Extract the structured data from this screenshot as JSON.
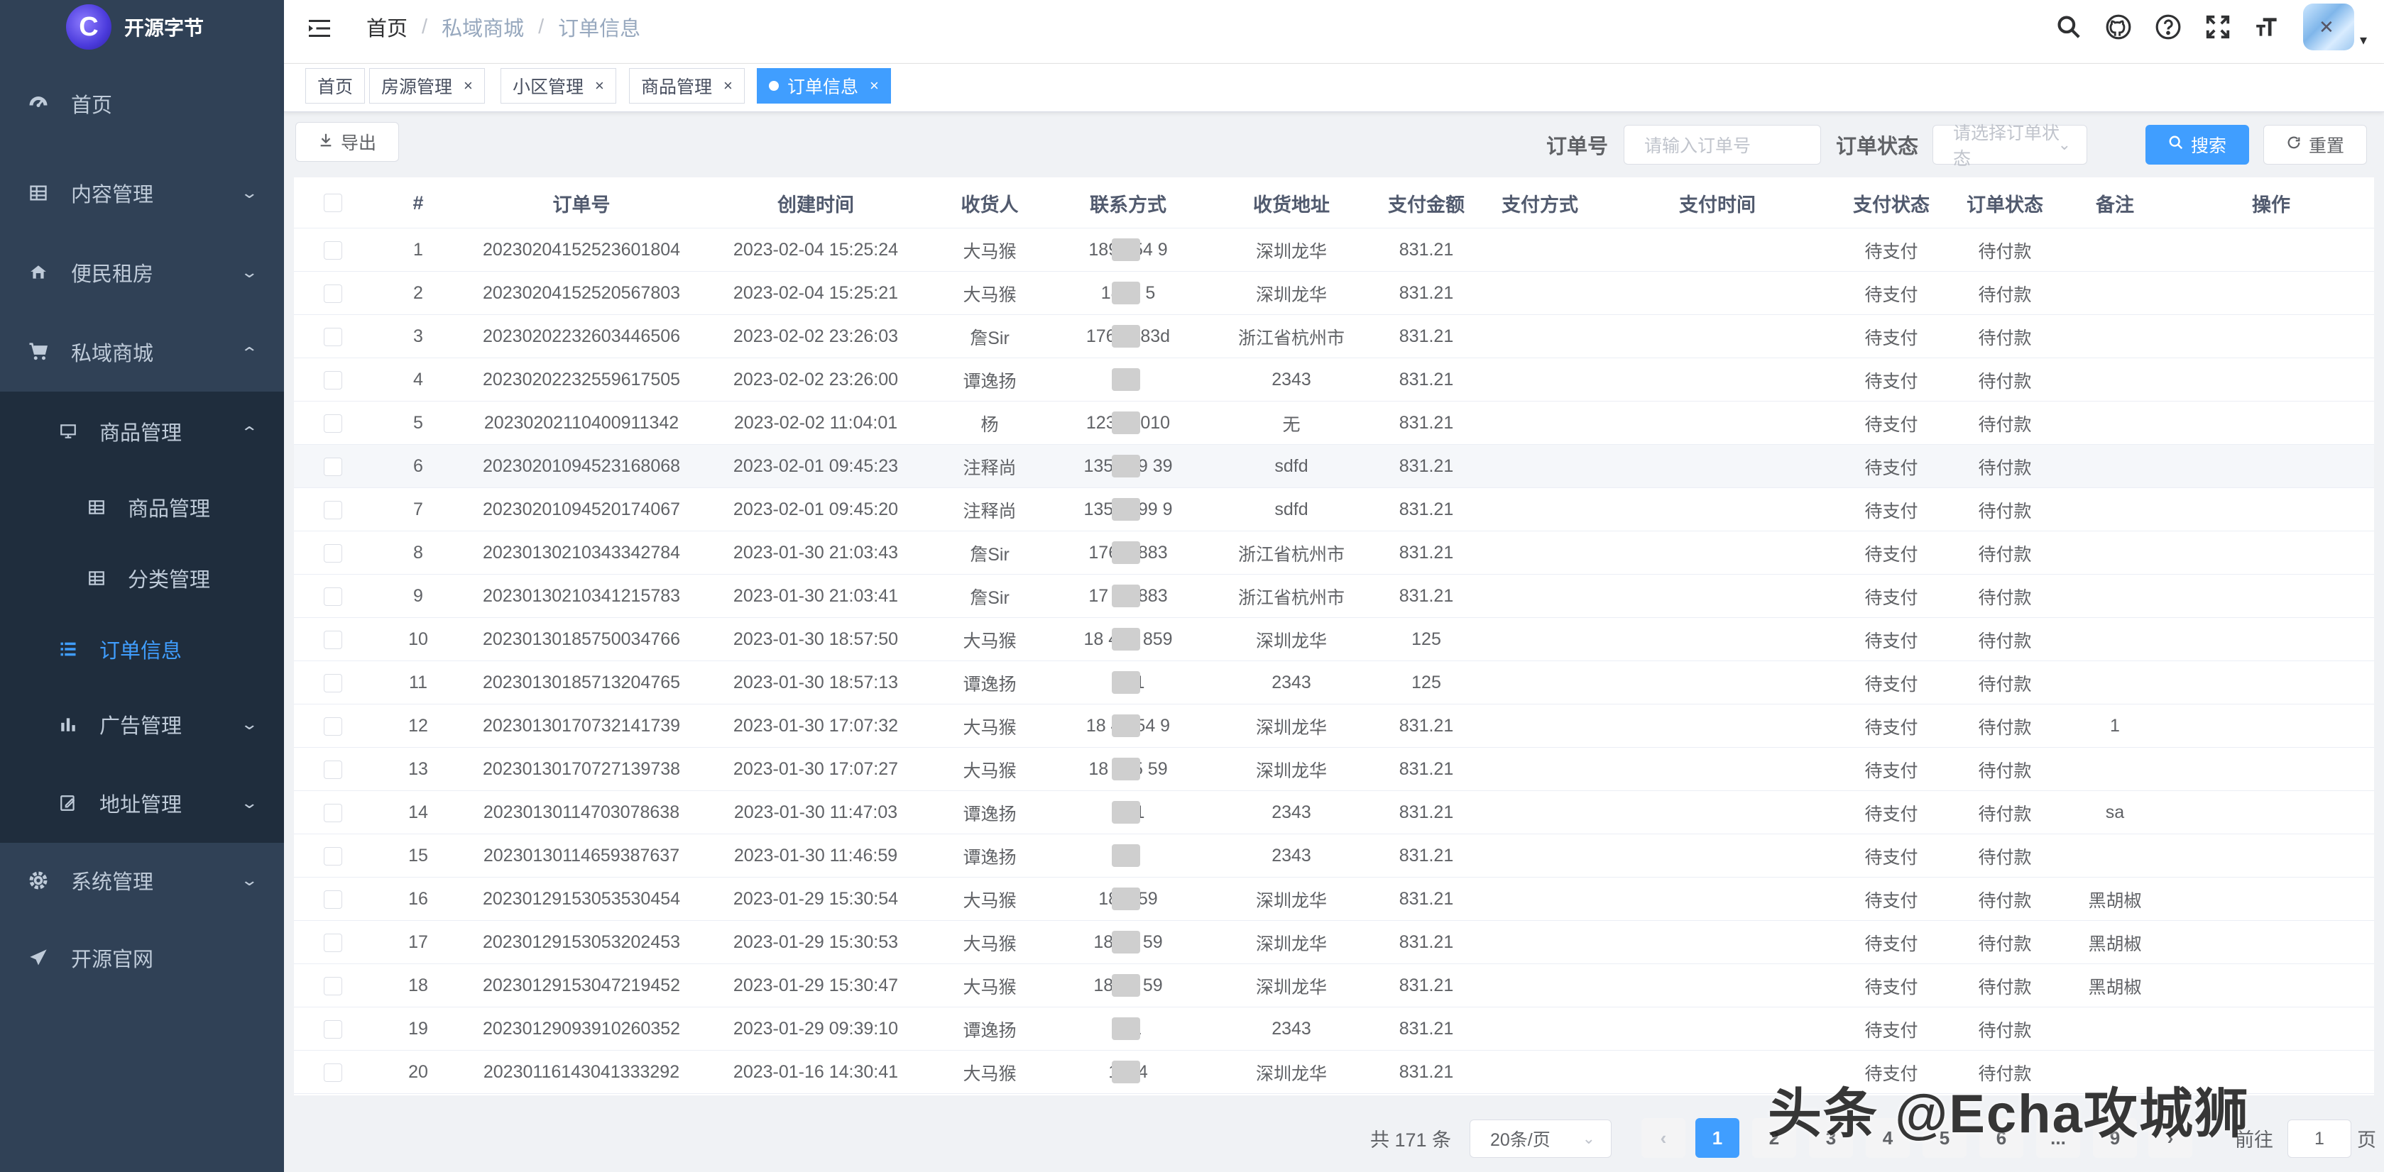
{
  "app": {
    "name": "开源字节",
    "logo_letter": "C"
  },
  "sidebar": {
    "items": [
      {
        "label": "首页",
        "icon": "dashboard-icon"
      },
      {
        "label": "内容管理",
        "icon": "table-icon"
      },
      {
        "label": "便民租房",
        "icon": "house-icon"
      },
      {
        "label": "私域商城",
        "icon": "cart-icon"
      },
      {
        "label": "商品管理",
        "icon": "monitor-icon"
      },
      {
        "label": "商品管理",
        "icon": "table-icon"
      },
      {
        "label": "分类管理",
        "icon": "table-icon"
      },
      {
        "label": "订单信息",
        "icon": "list-icon"
      },
      {
        "label": "广告管理",
        "icon": "bar-chart-icon"
      },
      {
        "label": "地址管理",
        "icon": "edit-icon"
      },
      {
        "label": "系统管理",
        "icon": "gear-icon"
      },
      {
        "label": "开源官网",
        "icon": "send-icon"
      }
    ]
  },
  "breadcrumb": [
    "首页",
    "私域商城",
    "订单信息"
  ],
  "tags": [
    {
      "label": "首页"
    },
    {
      "label": "房源管理"
    },
    {
      "label": "小区管理"
    },
    {
      "label": "商品管理"
    },
    {
      "label": "订单信息"
    }
  ],
  "toolbar": {
    "export_label": "导出",
    "order_no_label": "订单号",
    "order_no_placeholder": "请输入订单号",
    "order_status_label": "订单状态",
    "order_status_placeholder": "请选择订单状态",
    "search_label": "搜索",
    "reset_label": "重置"
  },
  "table": {
    "headers": [
      "#",
      "订单号",
      "创建时间",
      "收货人",
      "联系方式",
      "收货地址",
      "支付金额",
      "支付方式",
      "支付时间",
      "支付状态",
      "订单状态",
      "备注",
      "操作"
    ],
    "rows": [
      {
        "no": "1",
        "order": "20230204152523601804",
        "time": "2023-02-04 15:25:24",
        "name": "大马猴",
        "phone": "1894 54 9",
        "addr": "深圳龙华",
        "amount": "831.21",
        "pay_status": "待支付",
        "order_status": "待付款",
        "note": ""
      },
      {
        "no": "2",
        "order": "20230204152520567803",
        "time": "2023-02-04 15:25:21",
        "name": "大马猴",
        "phone": "1894 5",
        "addr": "深圳龙华",
        "amount": "831.21",
        "pay_status": "待支付",
        "order_status": "待付款",
        "note": ""
      },
      {
        "no": "3",
        "order": "20230202232603446506",
        "time": "2023-02-02 23:26:03",
        "name": "詹Sir",
        "phone": "17634 83d",
        "addr": "浙江省杭州市",
        "amount": "831.21",
        "pay_status": "待支付",
        "order_status": "待付款",
        "note": ""
      },
      {
        "no": "4",
        "order": "20230202232559617505",
        "time": "2023-02-02 23:26:00",
        "name": "谭逸扬",
        "phone": "1",
        "addr": "2343",
        "amount": "831.21",
        "pay_status": "待支付",
        "order_status": "待付款",
        "note": ""
      },
      {
        "no": "5",
        "order": "20230202110400911342",
        "time": "2023-02-02 11:04:01",
        "name": "杨",
        "phone": "12345 010",
        "addr": "无",
        "amount": "831.21",
        "pay_status": "待支付",
        "order_status": "待付款",
        "note": ""
      },
      {
        "no": "6",
        "order": "20230201094523168068",
        "time": "2023-02-01 09:45:23",
        "name": "注释尚",
        "phone": "1358 89 39",
        "addr": "sdfd",
        "amount": "831.21",
        "pay_status": "待支付",
        "order_status": "待付款",
        "note": ""
      },
      {
        "no": "7",
        "order": "20230201094520174067",
        "time": "2023-02-01 09:45:20",
        "name": "注释尚",
        "phone": "1358 899 9",
        "addr": "sdfd",
        "amount": "831.21",
        "pay_status": "待支付",
        "order_status": "待付款",
        "note": ""
      },
      {
        "no": "8",
        "order": "20230130210343342784",
        "time": "2023-01-30 21:03:43",
        "name": "詹Sir",
        "phone": "176 4 883",
        "addr": "浙江省杭州市",
        "amount": "831.21",
        "pay_status": "待支付",
        "order_status": "待付款",
        "note": ""
      },
      {
        "no": "9",
        "order": "20230130210341215783",
        "time": "2023-01-30 21:03:41",
        "name": "詹Sir",
        "phone": "17 46 883",
        "addr": "浙江省杭州市",
        "amount": "831.21",
        "pay_status": "待支付",
        "order_status": "待付款",
        "note": ""
      },
      {
        "no": "10",
        "order": "20230130185750034766",
        "time": "2023-01-30 18:57:50",
        "name": "大马猴",
        "phone": "18 426 859",
        "addr": "深圳龙华",
        "amount": "125",
        "pay_status": "待支付",
        "order_status": "待付款",
        "note": ""
      },
      {
        "no": "11",
        "order": "20230130185713204765",
        "time": "2023-01-30 18:57:13",
        "name": "谭逸扬",
        "phone": "11 1",
        "addr": "2343",
        "amount": "125",
        "pay_status": "待支付",
        "order_status": "待付款",
        "note": ""
      },
      {
        "no": "12",
        "order": "20230130170732141739",
        "time": "2023-01-30 17:07:32",
        "name": "大马猴",
        "phone": "18 4 654 9",
        "addr": "深圳龙华",
        "amount": "831.21",
        "pay_status": "待支付",
        "order_status": "待付款",
        "note": "1"
      },
      {
        "no": "13",
        "order": "20230130170727139738",
        "time": "2023-01-30 17:07:27",
        "name": "大马猴",
        "phone": "18 265 59",
        "addr": "深圳龙华",
        "amount": "831.21",
        "pay_status": "待支付",
        "order_status": "待付款",
        "note": ""
      },
      {
        "no": "14",
        "order": "20230130114703078638",
        "time": "2023-01-30 11:47:03",
        "name": "谭逸扬",
        "phone": "11 1",
        "addr": "2343",
        "amount": "831.21",
        "pay_status": "待支付",
        "order_status": "待付款",
        "note": "sa"
      },
      {
        "no": "15",
        "order": "20230130114659387637",
        "time": "2023-01-30 11:46:59",
        "name": "谭逸扬",
        "phone": "1",
        "addr": "2343",
        "amount": "831.21",
        "pay_status": "待支付",
        "order_status": "待付款",
        "note": ""
      },
      {
        "no": "16",
        "order": "20230129153053530454",
        "time": "2023-01-29 15:30:54",
        "name": "大马猴",
        "phone": "18 4 59",
        "addr": "深圳龙华",
        "amount": "831.21",
        "pay_status": "待支付",
        "order_status": "待付款",
        "note": "黑胡椒"
      },
      {
        "no": "17",
        "order": "20230129153053202453",
        "time": "2023-01-29 15:30:53",
        "name": "大马猴",
        "phone": "18 42 59",
        "addr": "深圳龙华",
        "amount": "831.21",
        "pay_status": "待支付",
        "order_status": "待付款",
        "note": "黑胡椒"
      },
      {
        "no": "18",
        "order": "20230129153047219452",
        "time": "2023-01-29 15:30:47",
        "name": "大马猴",
        "phone": "18 26 59",
        "addr": "深圳龙华",
        "amount": "831.21",
        "pay_status": "待支付",
        "order_status": "待付款",
        "note": "黑胡椒"
      },
      {
        "no": "19",
        "order": "20230129093910260352",
        "time": "2023-01-29 09:39:10",
        "name": "谭逸扬",
        "phone": "111",
        "addr": "2343",
        "amount": "831.21",
        "pay_status": "待支付",
        "order_status": "待付款",
        "note": ""
      },
      {
        "no": "20",
        "order": "20230116143041333292",
        "time": "2023-01-16 14:30:41",
        "name": "大马猴",
        "phone": "1894",
        "addr": "深圳龙华",
        "amount": "831.21",
        "pay_status": "待支付",
        "order_status": "待付款",
        "note": ""
      }
    ]
  },
  "pagination": {
    "total_text": "共 171 条",
    "page_size": "20条/页",
    "pages": [
      "1",
      "2",
      "3",
      "4",
      "5",
      "6",
      "...",
      "9"
    ],
    "current": "1",
    "goto_label": "前往",
    "goto_value": "1",
    "page_suffix": "页"
  },
  "watermark": "头条 @Echa攻城狮",
  "colors": {
    "primary": "#409eff",
    "sidebar": "#304156",
    "submenu": "#1f2d3d"
  }
}
